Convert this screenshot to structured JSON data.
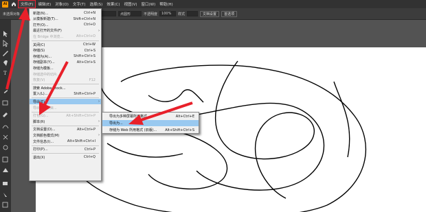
{
  "menubar": {
    "logo": "Ai",
    "items": [
      "文件(F)",
      "编辑(E)",
      "对象(O)",
      "文字(T)",
      "选择(S)",
      "效果(C)",
      "视图(V)",
      "窗口(W)",
      "帮助(H)"
    ],
    "active_index": 0
  },
  "controlbar": {
    "doc_label": "未选择对象",
    "basic": "基本",
    "opacity_label": "不透明度",
    "opacity_value": "100%",
    "style_label": "样式",
    "doc_setup": "文档设置",
    "preferences": "首选项",
    "stroke": "点圆形"
  },
  "file_menu": {
    "items": [
      {
        "label": "新建(N)...",
        "shortcut": "Ctrl+N",
        "type": "item"
      },
      {
        "label": "从模板新建(T)...",
        "shortcut": "Shift+Ctrl+N",
        "type": "item"
      },
      {
        "label": "打开(O)...",
        "shortcut": "Ctrl+O",
        "type": "item"
      },
      {
        "label": "最近打开的文件(F)",
        "shortcut": "",
        "type": "submenu"
      },
      {
        "label": "在 Bridge 中浏览...",
        "shortcut": "Alt+Ctrl+O",
        "type": "disabled"
      },
      {
        "type": "separator"
      },
      {
        "label": "关闭(C)",
        "shortcut": "Ctrl+W",
        "type": "item"
      },
      {
        "label": "存储(S)",
        "shortcut": "Ctrl+S",
        "type": "item"
      },
      {
        "label": "存储为(A)...",
        "shortcut": "Shift+Ctrl+S",
        "type": "item"
      },
      {
        "label": "存储副本(Y)...",
        "shortcut": "Alt+Ctrl+S",
        "type": "item"
      },
      {
        "label": "存储为模板...",
        "shortcut": "",
        "type": "item"
      },
      {
        "label": "存储选中的切片...",
        "shortcut": "",
        "type": "disabled"
      },
      {
        "label": "恢复(V)",
        "shortcut": "F12",
        "type": "disabled"
      },
      {
        "type": "separator"
      },
      {
        "label": "搜索 Adobe Stock...",
        "shortcut": "",
        "type": "item"
      },
      {
        "label": "置入(L)...",
        "shortcut": "Shift+Ctrl+P",
        "type": "item"
      },
      {
        "type": "separator"
      },
      {
        "label": "导出(E)",
        "shortcut": "",
        "type": "highlight-submenu"
      },
      {
        "label": "导出所选项目...",
        "shortcut": "",
        "type": "disabled"
      },
      {
        "type": "separator"
      },
      {
        "label": "打包(G)...",
        "shortcut": "Alt+Shift+Ctrl+P",
        "type": "disabled"
      },
      {
        "label": "脚本(R)",
        "shortcut": "",
        "type": "submenu"
      },
      {
        "type": "separator"
      },
      {
        "label": "文档设置(D)...",
        "shortcut": "Alt+Ctrl+P",
        "type": "item"
      },
      {
        "label": "文档颜色模式(M)",
        "shortcut": "",
        "type": "submenu"
      },
      {
        "label": "文件信息(I)...",
        "shortcut": "Alt+Shift+Ctrl+I",
        "type": "item"
      },
      {
        "type": "separator"
      },
      {
        "label": "打印(P)...",
        "shortcut": "Ctrl+P",
        "type": "item"
      },
      {
        "type": "separator"
      },
      {
        "label": "退出(X)",
        "shortcut": "Ctrl+Q",
        "type": "item"
      }
    ]
  },
  "export_submenu": {
    "items": [
      {
        "label": "导出为多种屏幕所用格式...",
        "shortcut": "Alt+Ctrl+E",
        "highlight": false
      },
      {
        "label": "导出为...",
        "shortcut": "",
        "highlight": true
      },
      {
        "label": "存储为 Web 所用格式 (旧版)...",
        "shortcut": "Alt+Shift+Ctrl+S",
        "highlight": false
      }
    ]
  },
  "colors": {
    "arrow": "#e8202a",
    "highlight": "#99c9f0",
    "menu_bg": "#f0f0f0",
    "app_bg": "#535353",
    "logo": "#ff9a00"
  }
}
